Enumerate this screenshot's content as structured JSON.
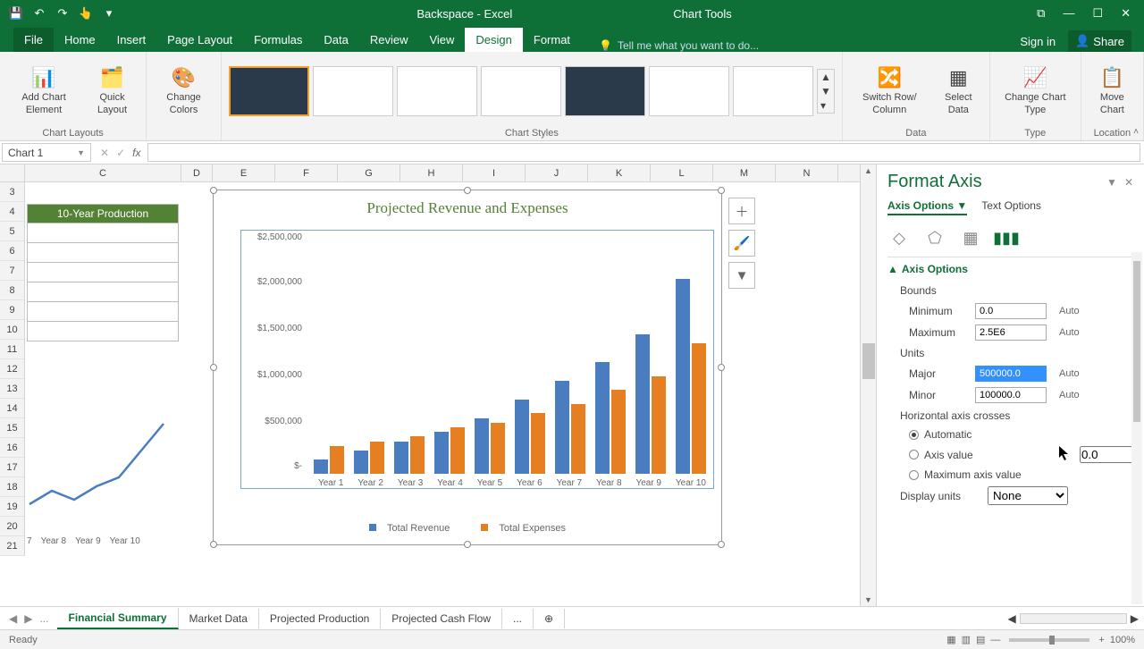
{
  "app": {
    "title": "Backspace - Excel",
    "context_title": "Chart Tools"
  },
  "qat": {
    "save": "💾",
    "undo": "↶",
    "redo": "↷",
    "touch": "👆"
  },
  "window_buttons": {
    "restore": "⧉",
    "min": "—",
    "max": "☐",
    "close": "✕"
  },
  "tabs": [
    "File",
    "Home",
    "Insert",
    "Page Layout",
    "Formulas",
    "Data",
    "Review",
    "View",
    "Design",
    "Format"
  ],
  "active_tab": "Design",
  "tellme": "Tell me what you want to do...",
  "signin": "Sign in",
  "share": "Share",
  "ribbon": {
    "chart_layouts": {
      "add_element": "Add Chart Element",
      "quick_layout": "Quick Layout",
      "label": "Chart Layouts"
    },
    "change_colors": "Change Colors",
    "chart_styles_label": "Chart Styles",
    "data": {
      "switch": "Switch Row/ Column",
      "select": "Select Data",
      "label": "Data"
    },
    "type": {
      "change": "Change Chart Type",
      "label": "Type"
    },
    "location": {
      "move": "Move Chart",
      "label": "Location"
    }
  },
  "namebox": "Chart 1",
  "columns": [
    "C",
    "D",
    "E",
    "F",
    "G",
    "H",
    "I",
    "J",
    "K",
    "L",
    "M",
    "N"
  ],
  "rows": [
    "3",
    "4",
    "5",
    "6",
    "7",
    "8",
    "9",
    "10",
    "11",
    "12",
    "13",
    "14",
    "15",
    "16",
    "17",
    "18",
    "19",
    "20",
    "21"
  ],
  "tenyear_label": "10-Year Production",
  "small_chart_x": [
    "7",
    "Year 8",
    "Year 9",
    "Year 10"
  ],
  "chart": {
    "title": "Projected Revenue and Expenses",
    "ylabels": [
      "$2,500,000",
      "$2,000,000",
      "$1,500,000",
      "$1,000,000",
      "$500,000",
      "$-"
    ],
    "xlabels": [
      "Year 1",
      "Year 2",
      "Year 3",
      "Year 4",
      "Year 5",
      "Year 6",
      "Year 7",
      "Year 8",
      "Year 9",
      "Year 10"
    ],
    "legend": {
      "rev": "Total Revenue",
      "exp": "Total Expenses"
    }
  },
  "chart_data": {
    "type": "bar",
    "title": "Projected Revenue and Expenses",
    "categories": [
      "Year 1",
      "Year 2",
      "Year 3",
      "Year 4",
      "Year 5",
      "Year 6",
      "Year 7",
      "Year 8",
      "Year 9",
      "Year 10"
    ],
    "series": [
      {
        "name": "Total Revenue",
        "values": [
          150000,
          250000,
          350000,
          450000,
          600000,
          800000,
          1000000,
          1200000,
          1500000,
          2100000
        ]
      },
      {
        "name": "Total Expenses",
        "values": [
          300000,
          350000,
          400000,
          500000,
          550000,
          650000,
          750000,
          900000,
          1050000,
          1400000
        ]
      }
    ],
    "ylabel": "",
    "xlabel": "",
    "ylim": [
      0,
      2500000
    ]
  },
  "pane": {
    "title": "Format Axis",
    "tab_axis": "Axis Options",
    "tab_text": "Text Options",
    "section": "Axis Options",
    "bounds": "Bounds",
    "minimum": "Minimum",
    "minimum_val": "0.0",
    "maximum": "Maximum",
    "maximum_val": "2.5E6",
    "units": "Units",
    "major": "Major",
    "major_val": "500000.0",
    "minor": "Minor",
    "minor_val": "100000.0",
    "auto": "Auto",
    "hcrosses": "Horizontal axis crosses",
    "automatic": "Automatic",
    "axis_value": "Axis value",
    "axis_value_val": "0.0",
    "max_axis": "Maximum axis value",
    "display_units": "Display units",
    "display_units_val": "None"
  },
  "sheet_tabs": {
    "nav_dots": "...",
    "tabs": [
      "Financial Summary",
      "Market Data",
      "Projected Production",
      "Projected Cash Flow"
    ],
    "active": "Financial Summary",
    "more": "...",
    "add": "⊕"
  },
  "status": {
    "ready": "Ready",
    "zoom": "100%"
  }
}
